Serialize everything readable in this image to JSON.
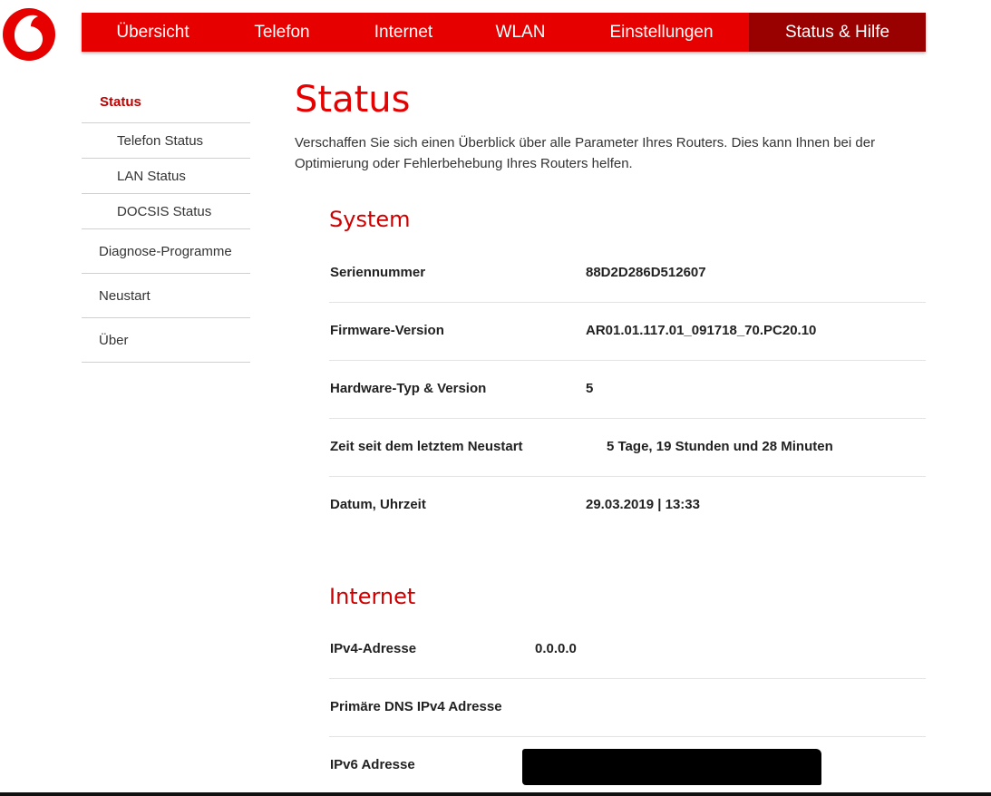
{
  "brand": {
    "accent": "#e60000",
    "active_tab": "#990000"
  },
  "topnav": {
    "tabs": [
      {
        "label": "Übersicht"
      },
      {
        "label": "Telefon"
      },
      {
        "label": "Internet"
      },
      {
        "label": "WLAN"
      },
      {
        "label": "Einstellungen"
      },
      {
        "label": "Status & Hilfe"
      }
    ]
  },
  "sidebar": {
    "header": "Status",
    "sub_items": [
      {
        "label": "Telefon Status"
      },
      {
        "label": "LAN Status"
      },
      {
        "label": "DOCSIS Status"
      }
    ],
    "items": [
      {
        "label": "Diagnose-Programme"
      },
      {
        "label": "Neustart"
      },
      {
        "label": "Über"
      }
    ]
  },
  "main": {
    "title": "Status",
    "intro": "Verschaffen Sie sich einen Überblick über alle Parameter Ihres Routers. Dies kann Ihnen bei der Optimierung oder Fehlerbehebung Ihres Routers helfen."
  },
  "system": {
    "title": "System",
    "rows": [
      {
        "label": "Seriennummer",
        "value": "88D2D286D512607"
      },
      {
        "label": "Firmware-Version",
        "value": "AR01.01.117.01_091718_70.PC20.10"
      },
      {
        "label": "Hardware-Typ & Version",
        "value": "5"
      },
      {
        "label": "Zeit seit dem letztem Neustart",
        "value": "5 Tage, 19 Stunden und 28 Minuten"
      },
      {
        "label": "Datum, Uhrzeit",
        "value": "29.03.2019 | 13:33"
      }
    ]
  },
  "internet": {
    "title": "Internet",
    "rows": [
      {
        "label": "IPv4-Adresse",
        "value": "0.0.0.0"
      },
      {
        "label": "Primäre DNS IPv4 Adresse",
        "value": ""
      },
      {
        "label": "IPv6 Adresse",
        "value": ""
      }
    ]
  }
}
